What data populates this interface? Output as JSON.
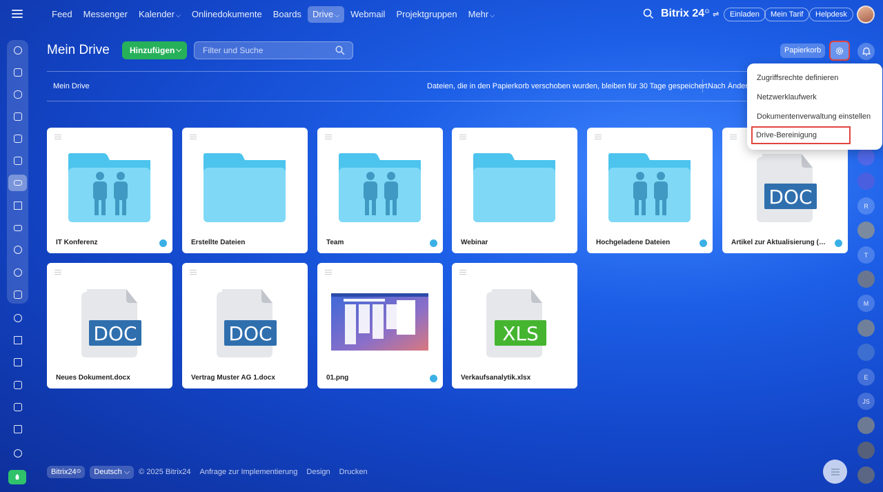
{
  "topbar": {
    "nav": [
      {
        "label": "Feed",
        "caret": false,
        "active": false
      },
      {
        "label": "Messenger",
        "caret": false,
        "active": false
      },
      {
        "label": "Kalender",
        "caret": true,
        "active": false
      },
      {
        "label": "Onlinedokumente",
        "caret": false,
        "active": false
      },
      {
        "label": "Boards",
        "caret": false,
        "active": false
      },
      {
        "label": "Drive",
        "caret": true,
        "active": true
      },
      {
        "label": "Webmail",
        "caret": false,
        "active": false
      },
      {
        "label": "Projektgruppen",
        "caret": false,
        "active": false
      },
      {
        "label": "Mehr",
        "caret": true,
        "active": false
      }
    ],
    "brand": "Bitrix 24",
    "buttons": {
      "invite": "Einladen",
      "plan": "Mein Tarif",
      "help": "Helpdesk"
    }
  },
  "header": {
    "title": "Mein Drive",
    "add_label": "Hinzufügen",
    "filter_placeholder": "Filter und Suche",
    "trash_label": "Papierkorb"
  },
  "toolbar": {
    "breadcrumb": "Mein Drive",
    "notice": "Dateien, die in den Papierkorb verschoben wurden, bleiben für 30 Tage gespeichert.",
    "sort_label": "Nach Änderungsdatum"
  },
  "menu": {
    "items": [
      "Zugriffsrechte definieren",
      "Netzwerklaufwerk",
      "Dokumentenverwaltung einstellen",
      "Drive-Bereinigung"
    ],
    "highlighted": "Drive-Bereinigung"
  },
  "files": [
    {
      "name": "IT Konferenz",
      "type": "folder-shared",
      "shared": true
    },
    {
      "name": "Erstellte Dateien",
      "type": "folder",
      "shared": false
    },
    {
      "name": "Team",
      "type": "folder-shared",
      "shared": true
    },
    {
      "name": "Webinar",
      "type": "folder",
      "shared": false
    },
    {
      "name": "Hochgeladene Dateien",
      "type": "folder-shared",
      "shared": true
    },
    {
      "name": "Artikel zur Aktualisierung (Mia...",
      "type": "doc",
      "badge": "DOC",
      "shared": true
    },
    {
      "name": "Neues Dokument.docx",
      "type": "doc",
      "badge": "DOC",
      "shared": false
    },
    {
      "name": "Vertrag Muster AG 1.docx",
      "type": "doc",
      "badge": "DOC",
      "shared": false
    },
    {
      "name": "01.png",
      "type": "image",
      "shared": true
    },
    {
      "name": "Verkaufsanalytik.xlsx",
      "type": "xls",
      "badge": "XLS",
      "shared": false
    }
  ],
  "right_avatars": [
    "R",
    "T",
    "M",
    "E",
    "JS"
  ],
  "footer": {
    "brand": "Bitrix24",
    "language": "Deutsch",
    "copyright": "© 2025 Bitrix24",
    "links": [
      "Anfrage zur Implementierung",
      "Design",
      "Drucken"
    ]
  },
  "colors": {
    "accent_green": "#27b05a",
    "highlight_red": "#e2443e",
    "folder_blue": "#7fd9f6",
    "doc_blue": "#2f6fae",
    "xls_green": "#45b530"
  }
}
